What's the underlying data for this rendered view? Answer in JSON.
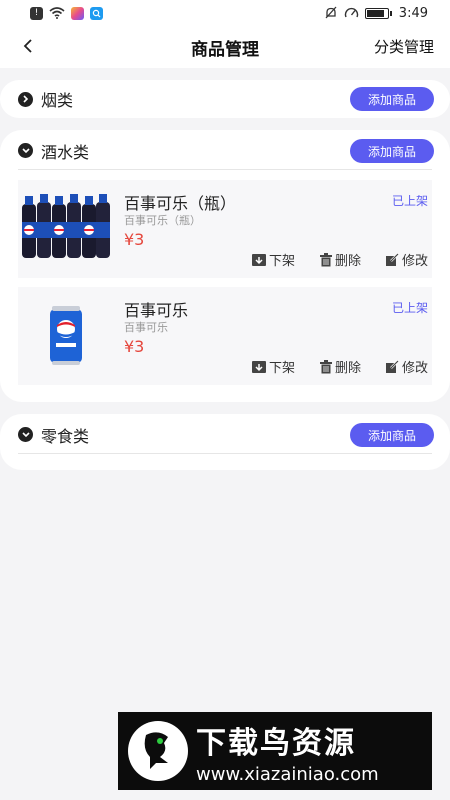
{
  "status_bar": {
    "time": "3:49",
    "battery_level": 0.85
  },
  "nav": {
    "title": "商品管理",
    "right_action": "分类管理"
  },
  "categories": [
    {
      "name": "烟类",
      "expanded": false,
      "add_label": "添加商品"
    },
    {
      "name": "酒水类",
      "expanded": true,
      "add_label": "添加商品"
    },
    {
      "name": "零食类",
      "expanded": true,
      "add_label": "添加商品"
    }
  ],
  "products": [
    {
      "name": "百事可乐（瓶）",
      "subtitle": "百事可乐（瓶）",
      "price": "¥3",
      "status": "已上架",
      "image": "pepsi-bottles-pack",
      "actions": {
        "off_shelf": "下架",
        "delete": "删除",
        "edit": "修改"
      }
    },
    {
      "name": "百事可乐",
      "subtitle": "百事可乐",
      "price": "¥3",
      "status": "已上架",
      "image": "pepsi-can",
      "actions": {
        "off_shelf": "下架",
        "delete": "删除",
        "edit": "修改"
      }
    }
  ],
  "watermark": {
    "title": "下载鸟资源",
    "url": "www.xiazainiao.com"
  },
  "colors": {
    "accent": "#5b5cf0",
    "price": "#e5473d",
    "page_background": "#f4f4f6"
  }
}
